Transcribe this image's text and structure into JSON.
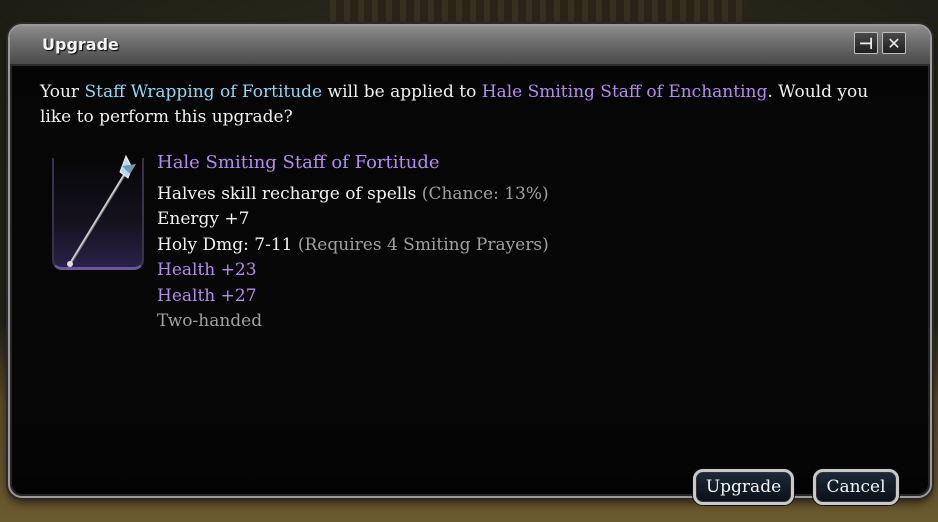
{
  "window": {
    "title": "Upgrade",
    "pin_glyph": "⊣",
    "close_glyph": "✕"
  },
  "message": {
    "part1": "Your ",
    "upgrade_component": "Staff Wrapping of Fortitude",
    "part2": " will be applied to ",
    "target_item": "Hale Smiting Staff of Enchanting",
    "part3": ". Would you like to perform this upgrade?"
  },
  "item": {
    "icon": "staff-icon",
    "name": "Hale Smiting Staff of Fortitude",
    "lines": {
      "l1_main": "Halves skill recharge of spells",
      "l1_note": " (Chance: 13%)",
      "l2": "Energy +7",
      "l3_main": "Holy Dmg: 7-11",
      "l3_note": " (Requires 4 Smiting Prayers)",
      "l4": "Health +23",
      "l5": "Health +27",
      "l6": "Two-handed"
    }
  },
  "buttons": {
    "upgrade": "Upgrade",
    "cancel": "Cancel"
  },
  "colors": {
    "cyan_highlight": "#8fd8f4",
    "purple_highlight": "#b48cf0",
    "grey_note": "#a0a0a0"
  }
}
